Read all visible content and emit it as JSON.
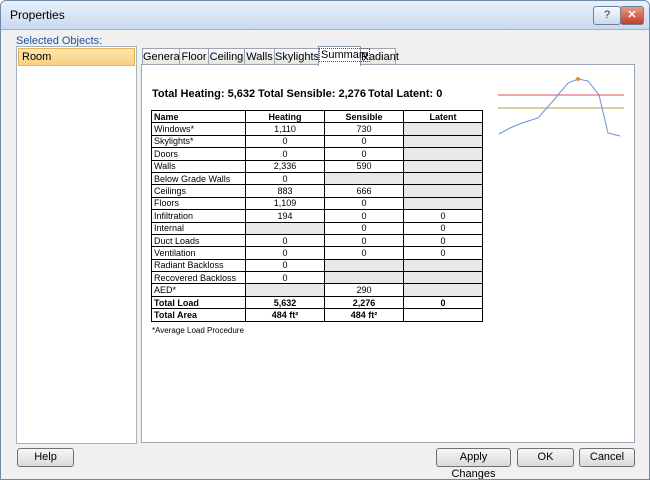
{
  "window": {
    "title": "Properties",
    "help_label": "?",
    "close_label": "✕"
  },
  "sidebar": {
    "label": "Selected Objects:",
    "items": [
      {
        "label": "Room"
      }
    ]
  },
  "tabs": [
    "General",
    "Floor",
    "Ceiling",
    "Walls",
    "Skylights",
    "Summary",
    "Radiant"
  ],
  "active_tab": "Summary",
  "totals": {
    "heating": "Total Heating: 5,632",
    "sensible": "Total Sensible: 2,276",
    "latent": "Total Latent: 0"
  },
  "table": {
    "headers": [
      "Name",
      "Heating",
      "Sensible",
      "Latent"
    ],
    "rows": [
      [
        "Windows*",
        "1,110",
        "730",
        ""
      ],
      [
        "Skylights*",
        "0",
        "0",
        ""
      ],
      [
        "Doors",
        "0",
        "0",
        ""
      ],
      [
        "Walls",
        "2,336",
        "590",
        ""
      ],
      [
        "Below Grade Walls",
        "0",
        "",
        ""
      ],
      [
        "Ceilings",
        "883",
        "666",
        ""
      ],
      [
        "Floors",
        "1,109",
        "0",
        ""
      ],
      [
        "Infiltration",
        "194",
        "0",
        "0"
      ],
      [
        "Internal",
        "",
        "0",
        "0"
      ],
      [
        "Duct Loads",
        "0",
        "0",
        "0"
      ],
      [
        "Ventilation",
        "0",
        "0",
        "0"
      ],
      [
        "Radiant Backloss",
        "0",
        "",
        ""
      ],
      [
        "Recovered Backloss",
        "0",
        "",
        ""
      ],
      [
        "AED*",
        "",
        "290",
        ""
      ],
      [
        "Total Load",
        "5,632",
        "2,276",
        "0"
      ],
      [
        "Total Area",
        "484 ft²",
        "484 ft²",
        ""
      ]
    ],
    "gray_cells": [
      [
        0,
        3
      ],
      [
        1,
        3
      ],
      [
        2,
        3
      ],
      [
        3,
        3
      ],
      [
        4,
        2
      ],
      [
        4,
        3
      ],
      [
        5,
        3
      ],
      [
        6,
        3
      ],
      [
        8,
        1
      ],
      [
        11,
        2
      ],
      [
        11,
        3
      ],
      [
        12,
        2
      ],
      [
        12,
        3
      ],
      [
        13,
        1
      ],
      [
        13,
        3
      ]
    ]
  },
  "footnote": "*Average Load Procedure",
  "colors": {
    "curve": "#6b8fd9",
    "red_line": "#e05050",
    "olive_line": "#b5a13a",
    "peak_dot": "#f08c28"
  },
  "buttons": {
    "help": "Help",
    "apply": "Apply Changes",
    "ok": "OK",
    "cancel": "Cancel"
  }
}
